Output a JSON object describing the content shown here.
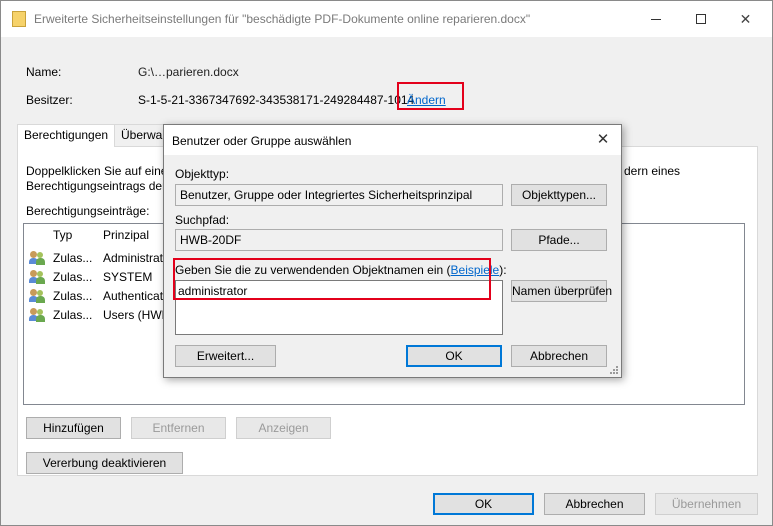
{
  "window": {
    "title": "Erweiterte Sicherheitseinstellungen für \"beschädigte PDF-Dokumente online reparieren.docx\"",
    "minimize_glyph": "—",
    "maximize_glyph": "☐",
    "close_glyph": "✕"
  },
  "info": {
    "name_label": "Name:",
    "name_value": "G:\\…parieren.docx",
    "owner_label": "Besitzer:",
    "owner_value": "S-1-5-21-3367347692-343538171-249284487-1014",
    "owner_change_link": "Ändern"
  },
  "tabs": [
    {
      "label": "Berechtigungen",
      "active": true
    },
    {
      "label": "Überwa",
      "active": false
    }
  ],
  "panel": {
    "instruction_line1_start": "Doppelklicken Sie auf eine",
    "instruction_line1_end": "dern eines",
    "instruction_line2": "Berechtigungseintrags der",
    "entries_label": "Berechtigungseinträge:",
    "columns": [
      "Typ",
      "Prinzipal"
    ],
    "rows": [
      {
        "type": "Zulas...",
        "principal": "Administrat"
      },
      {
        "type": "Zulas...",
        "principal": "SYSTEM"
      },
      {
        "type": "Zulas...",
        "principal": "Authenticat"
      },
      {
        "type": "Zulas...",
        "principal": "Users (HWB"
      }
    ]
  },
  "panel_buttons": {
    "add": "Hinzufügen",
    "remove": "Entfernen",
    "view": "Anzeigen",
    "disable_inheritance": "Vererbung deaktivieren"
  },
  "footer_buttons": {
    "ok": "OK",
    "cancel": "Abbrechen",
    "apply": "Übernehmen"
  },
  "dialog": {
    "title": "Benutzer oder Gruppe auswählen",
    "close_glyph": "✕",
    "object_type_label": "Objekttyp:",
    "object_type_value": "Benutzer, Gruppe oder Integriertes Sicherheitsprinzipal",
    "object_types_button": "Objekttypen...",
    "search_path_label": "Suchpfad:",
    "search_path_value": "HWB-20DF",
    "paths_button": "Pfade...",
    "names_label": "Geben Sie die zu verwendenden Objektnamen ein (",
    "names_label_link": "Beispiele",
    "names_label_end": "):",
    "names_value": "administrator",
    "check_names_button": "Namen überprüfen",
    "advanced_button": "Erweitert...",
    "ok_button": "OK",
    "cancel_button": "Abbrechen"
  },
  "colors": {
    "highlight_red": "#e3001b",
    "link_blue": "#0066cc",
    "default_button_blue": "#0078d7"
  }
}
